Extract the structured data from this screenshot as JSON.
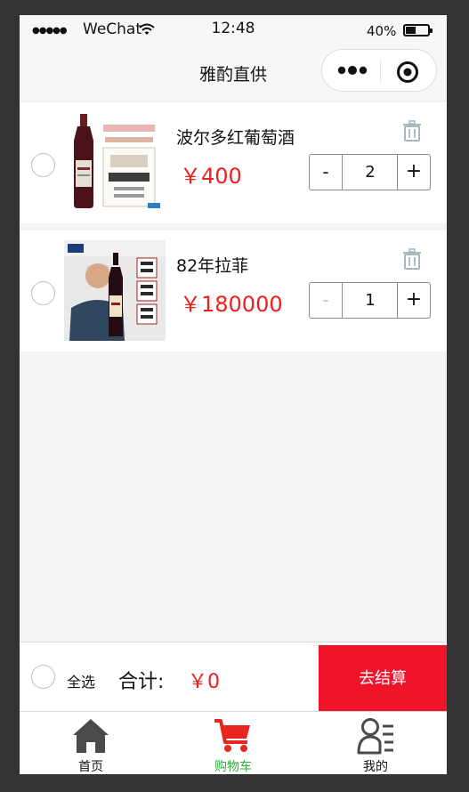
{
  "status_bar": {
    "signal": "●●●●●",
    "carrier": "WeChat",
    "time": "12:48",
    "battery": "40%"
  },
  "nav": {
    "title": "雅酌直供"
  },
  "cart": {
    "items": [
      {
        "name": "波尔多红葡萄酒",
        "price": "￥400",
        "quantity": "2",
        "minus": "-",
        "plus": "+",
        "minus_disabled": false,
        "image": "bordeaux-wine-photo"
      },
      {
        "name": "82年拉菲",
        "price": "￥180000",
        "quantity": "1",
        "minus": "-",
        "plus": "+",
        "minus_disabled": true,
        "image": "lafite-1982-photo"
      }
    ]
  },
  "footer": {
    "select_all": "全选",
    "total_label": "合计:",
    "total_value": "￥0",
    "checkout": "去结算"
  },
  "tabbar": {
    "tabs": [
      {
        "label": "首页",
        "icon": "home-icon",
        "active": false
      },
      {
        "label": "购物车",
        "icon": "cart-icon",
        "active": true
      },
      {
        "label": "我的",
        "icon": "user-list-icon",
        "active": false
      }
    ]
  },
  "colors": {
    "accent_red": "#f0142b",
    "price_red": "#f21d1d",
    "active_tab": "#2fae3a",
    "background": "#f3f4f6"
  }
}
